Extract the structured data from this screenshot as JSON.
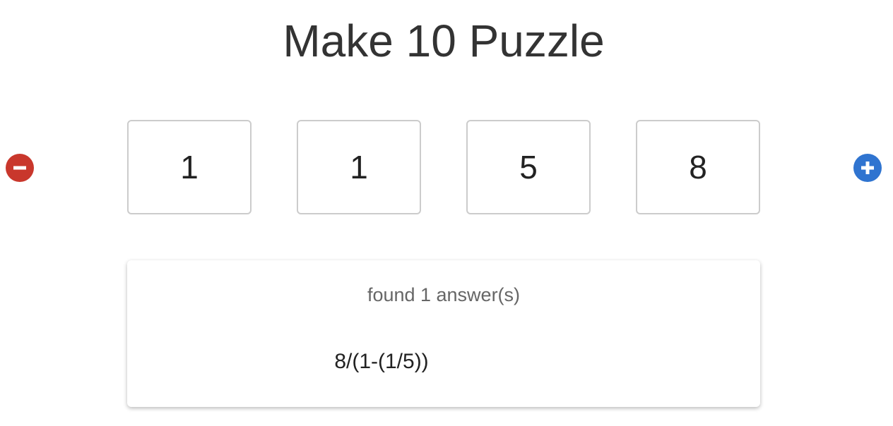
{
  "title": "Make 10 Puzzle",
  "controls": {
    "remove_icon": "minus-circle-icon",
    "add_icon": "plus-circle-icon",
    "remove_color": "#c9372c",
    "add_color": "#2f74d0"
  },
  "numbers": [
    "1",
    "1",
    "5",
    "8"
  ],
  "results": {
    "summary": "found 1 answer(s)",
    "answers": [
      "8/(1-(1/5))"
    ]
  }
}
